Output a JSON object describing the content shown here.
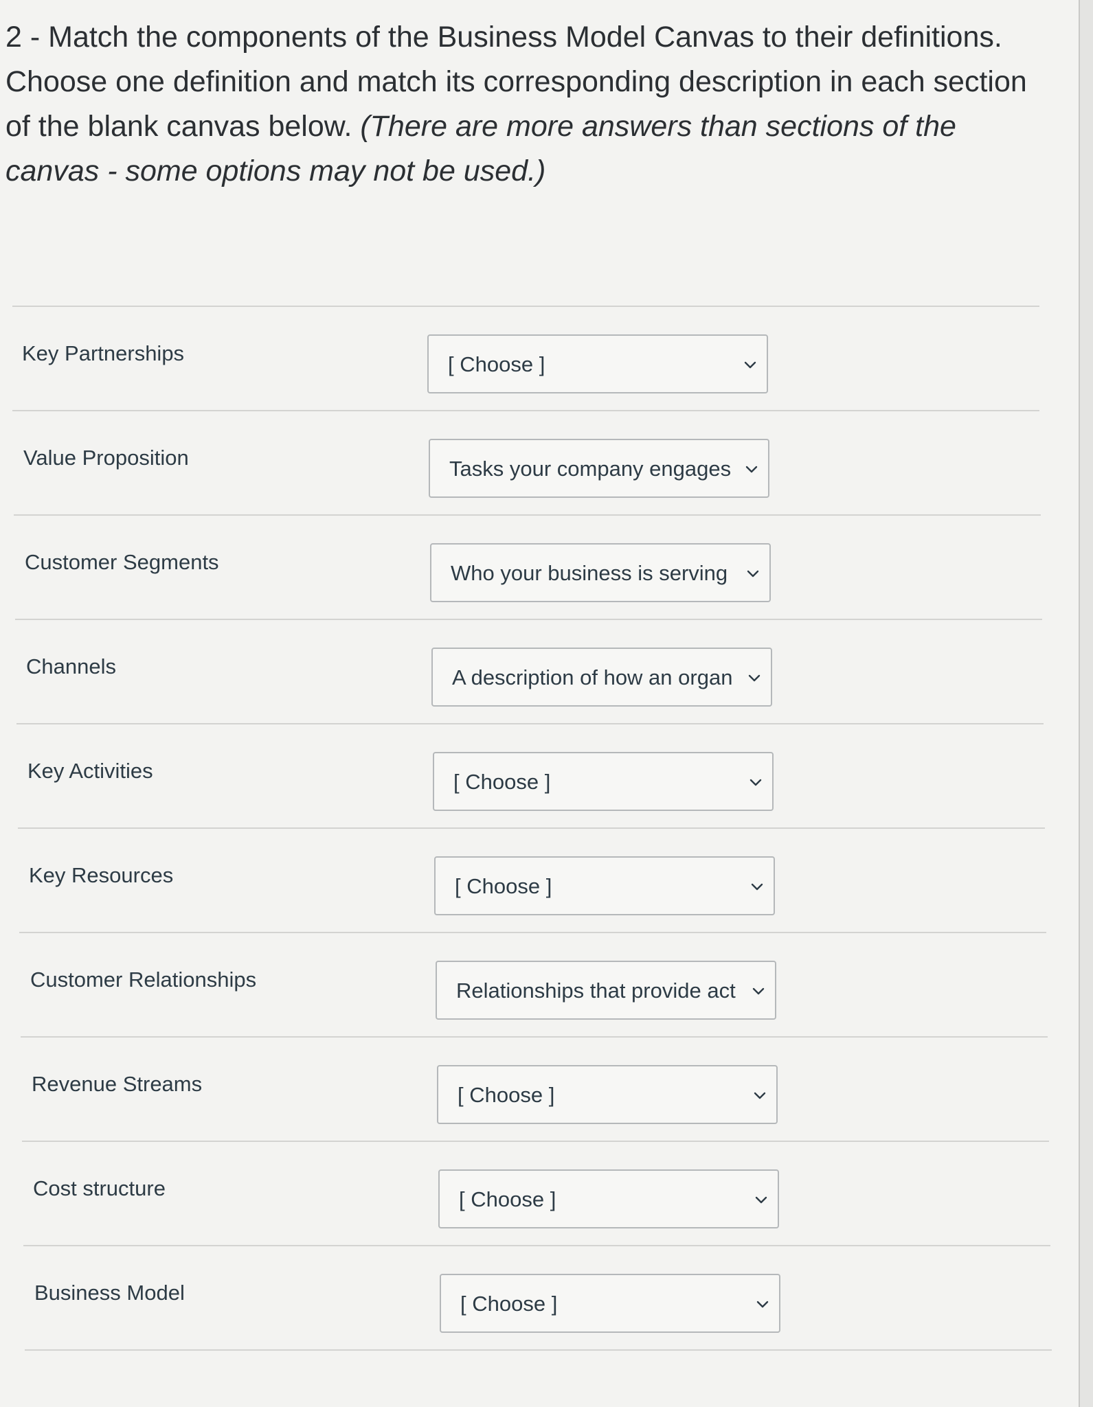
{
  "question": {
    "number": "2",
    "text_line": "2 - Match the components of the Business Model Canvas to their definitions. Choose one definition and match its corresponding description in each section of the blank canvas below. ",
    "note": "(There are more answers than sections of the canvas - some options may not be used.)"
  },
  "rows": [
    {
      "label": "Key Partnerships",
      "selected": "[ Choose ]"
    },
    {
      "label": "Value Proposition",
      "selected": "Tasks your company engages i"
    },
    {
      "label": "Customer Segments",
      "selected": "Who your business is serving"
    },
    {
      "label": "Channels",
      "selected": "A description of how an organ"
    },
    {
      "label": "Key Activities",
      "selected": "[ Choose ]"
    },
    {
      "label": "Key Resources",
      "selected": "[ Choose ]"
    },
    {
      "label": "Customer Relationships",
      "selected": "Relationships that provide act"
    },
    {
      "label": "Revenue Streams",
      "selected": "[ Choose ]"
    },
    {
      "label": "Cost structure",
      "selected": "[ Choose ]"
    },
    {
      "label": "Business Model",
      "selected": "[ Choose ]"
    }
  ],
  "icons": {
    "dropdown": "chevron-down-icon"
  }
}
